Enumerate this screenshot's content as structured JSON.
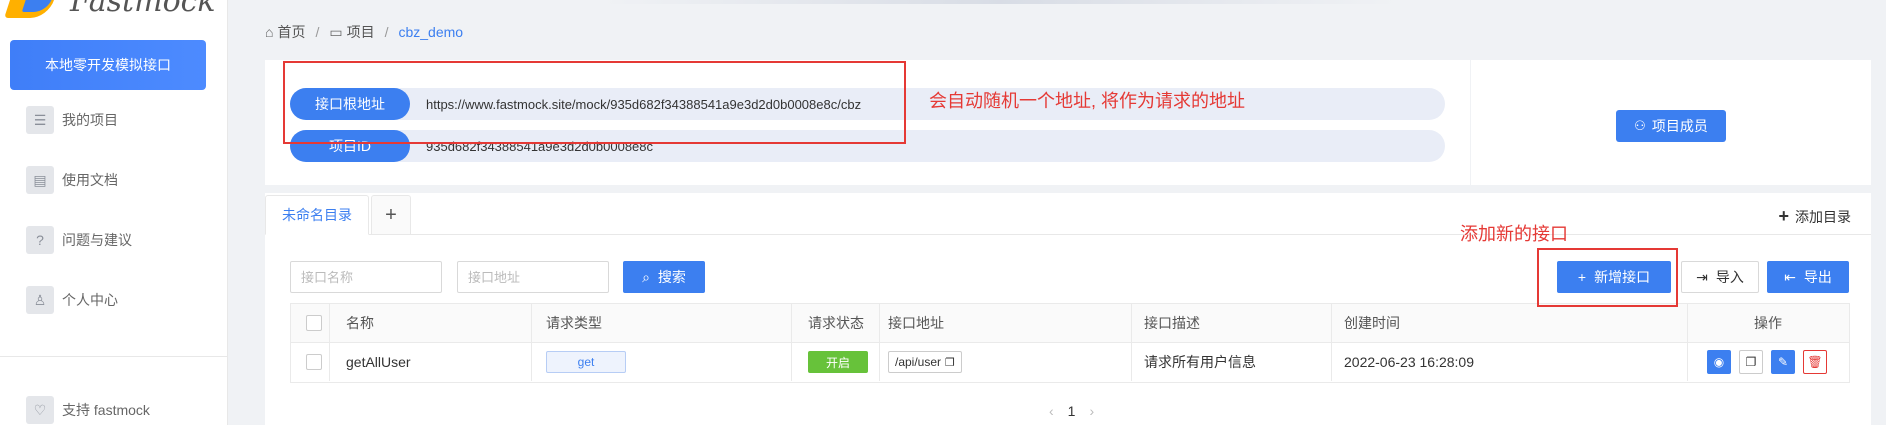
{
  "sidebar": {
    "brand": "Fastmock",
    "local_button": "本地零开发模拟接口",
    "items": [
      {
        "label": "我的项目",
        "icon": "list-icon"
      },
      {
        "label": "使用文档",
        "icon": "document-icon"
      },
      {
        "label": "问题与建议",
        "icon": "question-icon"
      },
      {
        "label": "个人中心",
        "icon": "user-icon"
      }
    ],
    "support": "支持 fastmock"
  },
  "breadcrumb": {
    "home": "首页",
    "project": "项目",
    "current": "cbz_demo",
    "separator": "/"
  },
  "info": {
    "root_label": "接口根地址",
    "root_value": "https://www.fastmock.site/mock/935d682f34388541a9e3d2d0b0008e8c/cbz",
    "id_label": "项目ID",
    "id_value": "935d682f34388541a9e3d2d0b0008e8c",
    "member_button": "项目成员"
  },
  "annotations": {
    "root_note": "会自动随机一个地址, 将作为请求的地址",
    "add_note": "添加新的接口"
  },
  "tabs": {
    "active": "未命名目录",
    "add": "+",
    "add_dir": "添加目录"
  },
  "search": {
    "name_placeholder": "接口名称",
    "path_placeholder": "接口地址",
    "search_button": "搜索"
  },
  "actions": {
    "new_api": "新增接口",
    "import": "导入",
    "export": "导出"
  },
  "table": {
    "headers": [
      "名称",
      "请求类型",
      "请求状态",
      "接口地址",
      "接口描述",
      "创建时间",
      "操作"
    ],
    "rows": [
      {
        "name": "getAllUser",
        "method": "get",
        "status": "开启",
        "path": "/api/user",
        "desc": "请求所有用户信息",
        "created": "2022-06-23 16:28:09"
      }
    ]
  },
  "pagination": {
    "current": "1"
  },
  "colors": {
    "primary": "#3c7ff0",
    "success": "#67c23a",
    "annotation": "#e53935"
  }
}
